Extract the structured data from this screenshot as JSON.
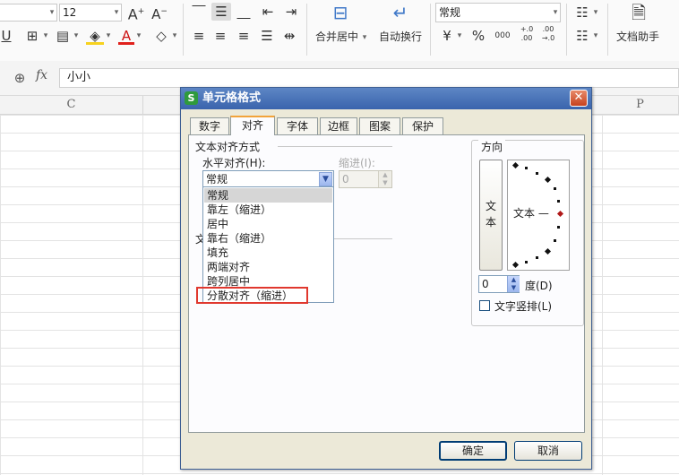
{
  "ribbon": {
    "font_size": "12",
    "font_grow_icon": "A⁺",
    "font_shrink_icon": "A⁻",
    "number_format": "常规",
    "merge_center_label": "合并居中",
    "wrap_text_label": "自动换行",
    "doc_assistant_label": "文档助手",
    "percent_symbol": "%",
    "thousands_symbol": "000",
    "increase_decimal": "+.0\n.00",
    "decrease_decimal": ".00\n→.0"
  },
  "formula_bar": {
    "fx_label": "fx",
    "cell_content": "小小"
  },
  "sheet": {
    "col_c": "C",
    "col_p": "P"
  },
  "dialog": {
    "title": "单元格格式",
    "app_icon": "S",
    "close_label": "✕",
    "tabs": [
      {
        "label": "数字"
      },
      {
        "label": "对齐"
      },
      {
        "label": "字体"
      },
      {
        "label": "边框"
      },
      {
        "label": "图案"
      },
      {
        "label": "保护"
      }
    ],
    "text_align_group": "文本对齐方式",
    "horizontal_label": "水平对齐(H):",
    "horizontal_value": "常规",
    "indent_label": "缩进(I):",
    "indent_value": "0",
    "horizontal_options": [
      "常规",
      "靠左（缩进）",
      "居中",
      "靠右（缩进）",
      "填充",
      "两端对齐",
      "跨列居中",
      "分散对齐（缩进）"
    ],
    "behind_label_prefix": "文",
    "orientation_group": "方向",
    "vertical_text": "文\n本",
    "orientation_text": "文本 —",
    "degree_value": "0",
    "degree_label": "度(D)",
    "vertical_stack_label": "文字竖排(L)",
    "ok_label": "确定",
    "cancel_label": "取消"
  },
  "colors": {
    "title_bar": "#3a64ad",
    "highlight_box": "#e0382e",
    "active_tab_accent": "#f2a33a",
    "selected_item_bg": "#d6d6d6"
  }
}
